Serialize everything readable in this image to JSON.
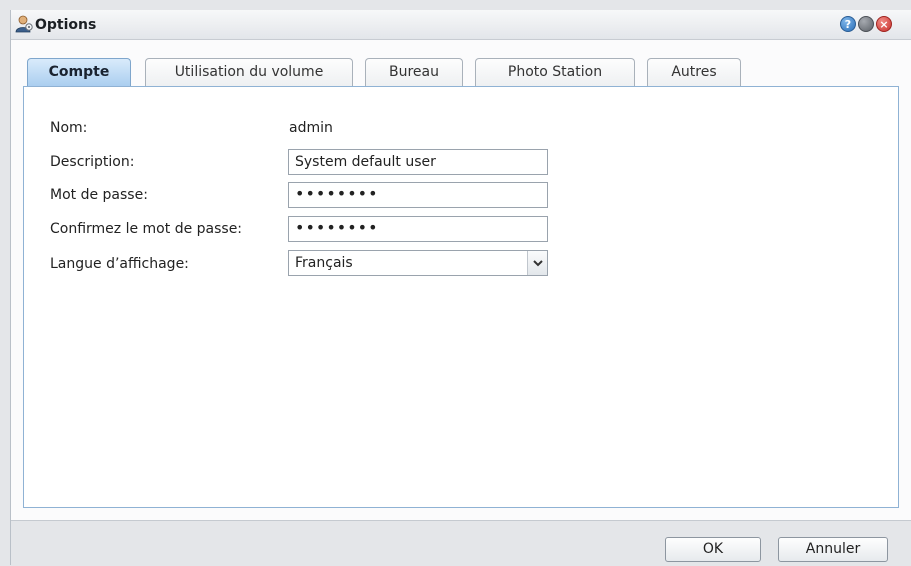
{
  "window": {
    "title": "Options"
  },
  "tabs": [
    {
      "label": "Compte",
      "active": true
    },
    {
      "label": "Utilisation du volume",
      "active": false
    },
    {
      "label": "Bureau",
      "active": false
    },
    {
      "label": "Photo Station",
      "active": false
    },
    {
      "label": "Autres",
      "active": false
    }
  ],
  "form": {
    "name_label": "Nom:",
    "name_value": "admin",
    "description_label": "Description:",
    "description_value": "System default user",
    "password_label": "Mot de passe:",
    "password_value": "••••••••",
    "confirm_label": "Confirmez le mot de passe:",
    "confirm_value": "••••••••",
    "language_label": "Langue d’affichage:",
    "language_value": "Français"
  },
  "buttons": {
    "ok": "OK",
    "cancel": "Annuler"
  },
  "icons": {
    "title": "user-options-icon",
    "help": "help-icon",
    "minimize": "minimize-icon",
    "close": "close-icon",
    "dropdown": "chevron-down-icon"
  },
  "colors": {
    "active_tab": "#a9cdef",
    "panel_border": "#8fb2d4",
    "close": "#c9302c",
    "help": "#2b6fb8"
  }
}
